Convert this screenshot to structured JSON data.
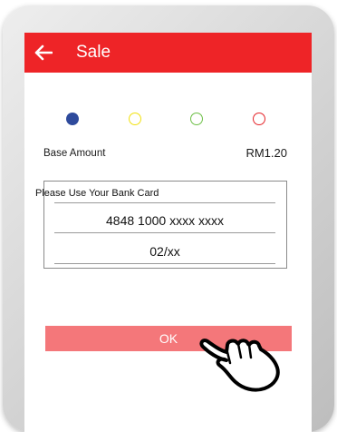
{
  "header": {
    "title": "Sale",
    "back_icon": "back-arrow-icon",
    "color": "#ee2427"
  },
  "progress_steps": {
    "colors": [
      "#2e4a9c",
      "#f2e10f",
      "#6cbf45",
      "#e5252a"
    ],
    "active_index": 0
  },
  "amount": {
    "label": "Base Amount",
    "value": "RM1.20"
  },
  "card": {
    "prompt": "Please Use Your Bank Card",
    "number": "4848 1000 xxxx xxxx",
    "expiry": "02/xx"
  },
  "actions": {
    "ok_label": "OK",
    "ok_color": "#f4777a"
  },
  "pointer_icon": "tap-hand-icon"
}
